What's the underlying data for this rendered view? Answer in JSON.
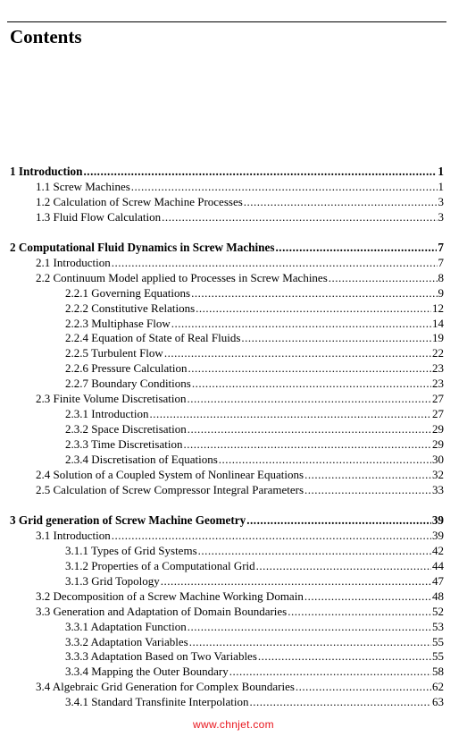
{
  "heading": "Contents",
  "toc": [
    {
      "level": 0,
      "label": "1 Introduction",
      "page": "1"
    },
    {
      "level": 1,
      "label": "1.1 Screw Machines",
      "page": "1"
    },
    {
      "level": 1,
      "label": "1.2 Calculation of Screw Machine Processes",
      "page": "3"
    },
    {
      "level": 1,
      "label": "1.3 Fluid Flow Calculation",
      "page": "3"
    },
    {
      "level": 0,
      "label": "2 Computational Fluid Dynamics in Screw Machines",
      "page": "7"
    },
    {
      "level": 1,
      "label": "2.1 Introduction",
      "page": "7"
    },
    {
      "level": 1,
      "label": "2.2 Continuum Model applied to Processes in Screw Machines",
      "page": "8"
    },
    {
      "level": 2,
      "label": "2.2.1 Governing Equations",
      "page": "9"
    },
    {
      "level": 2,
      "label": "2.2.2 Constitutive Relations",
      "page": "12"
    },
    {
      "level": 2,
      "label": "2.2.3 Multiphase Flow",
      "page": "14"
    },
    {
      "level": 2,
      "label": "2.2.4 Equation of State of Real Fluids",
      "page": "19"
    },
    {
      "level": 2,
      "label": "2.2.5 Turbulent Flow",
      "page": "22"
    },
    {
      "level": 2,
      "label": "2.2.6 Pressure Calculation",
      "page": "23"
    },
    {
      "level": 2,
      "label": "2.2.7 Boundary Conditions",
      "page": "23"
    },
    {
      "level": 1,
      "label": "2.3 Finite Volume Discretisation",
      "page": "27"
    },
    {
      "level": 2,
      "label": "2.3.1 Introduction",
      "page": "27"
    },
    {
      "level": 2,
      "label": "2.3.2 Space Discretisation",
      "page": "29"
    },
    {
      "level": 2,
      "label": "2.3.3 Time Discretisation",
      "page": "29"
    },
    {
      "level": 2,
      "label": "2.3.4 Discretisation of Equations",
      "page": "30"
    },
    {
      "level": 1,
      "label": "2.4 Solution of a Coupled System of Nonlinear Equations",
      "page": "32"
    },
    {
      "level": 1,
      "label": "2.5 Calculation of Screw Compressor Integral Parameters",
      "page": "33"
    },
    {
      "level": 0,
      "label": "3 Grid generation of Screw Machine Geometry",
      "page": "39"
    },
    {
      "level": 1,
      "label": "3.1 Introduction",
      "page": "39"
    },
    {
      "level": 2,
      "label": "3.1.1 Types of Grid Systems",
      "page": "42"
    },
    {
      "level": 2,
      "label": "3.1.2 Properties of a Computational Grid",
      "page": "44"
    },
    {
      "level": 2,
      "label": "3.1.3 Grid Topology",
      "page": "47"
    },
    {
      "level": 1,
      "label": "3.2 Decomposition of a Screw Machine Working Domain",
      "page": "48"
    },
    {
      "level": 1,
      "label": "3.3 Generation and Adaptation of Domain Boundaries",
      "page": "52"
    },
    {
      "level": 2,
      "label": "3.3.1 Adaptation Function",
      "page": "53"
    },
    {
      "level": 2,
      "label": "3.3.2 Adaptation Variables",
      "page": "55"
    },
    {
      "level": 2,
      "label": "3.3.3 Adaptation Based on Two Variables",
      "page": "55"
    },
    {
      "level": 2,
      "label": "3.3.4 Mapping the Outer Boundary",
      "page": "58"
    },
    {
      "level": 1,
      "label": "3.4 Algebraic Grid Generation for Complex Boundaries",
      "page": "62"
    },
    {
      "level": 2,
      "label": "3.4.1 Standard Transfinite Interpolation",
      "page": "63"
    }
  ],
  "watermark": "www.chnjet.com"
}
